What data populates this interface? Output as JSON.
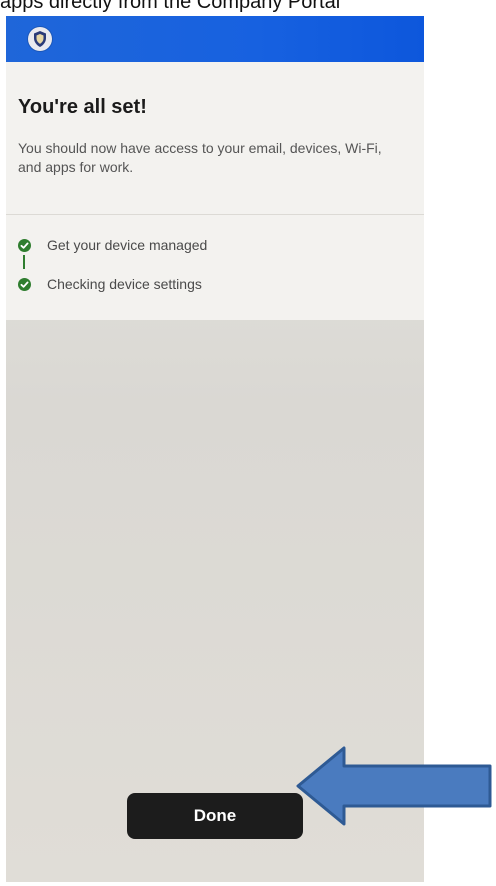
{
  "caption": "apps directly from the Company Portal",
  "header": {
    "logo_icon": "shield-icon",
    "bar_color": "#1761e0"
  },
  "card": {
    "title": "You're all set!",
    "subtitle": "You should now have access to your email, devices, Wi-Fi, and apps for work."
  },
  "steps": [
    {
      "label": "Get your device managed",
      "status": "complete",
      "icon": "check-circle-icon"
    },
    {
      "label": "Checking device settings",
      "status": "complete",
      "icon": "check-circle-icon"
    }
  ],
  "done_button": {
    "label": "Done"
  },
  "annotation": {
    "icon": "left-arrow-icon",
    "color": "#4a7bbf"
  },
  "colors": {
    "accent": "#1761e0",
    "success": "#2f7d2f",
    "button": "#1c1c1c"
  }
}
